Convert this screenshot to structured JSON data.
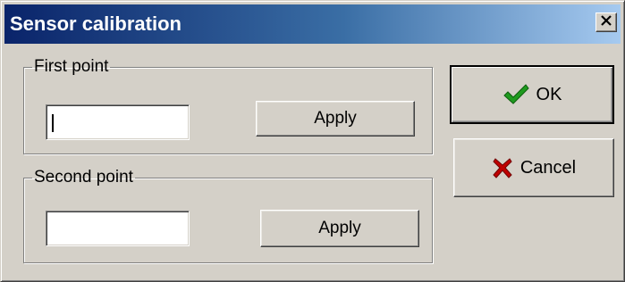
{
  "window": {
    "title": "Sensor calibration",
    "close_label": "X"
  },
  "groups": [
    {
      "legend": "First point",
      "input_value": "",
      "apply_label": "Apply"
    },
    {
      "legend": "Second point",
      "input_value": "",
      "apply_label": "Apply"
    }
  ],
  "actions": {
    "ok_label": "OK",
    "cancel_label": "Cancel",
    "ok_icon": "checkmark-icon",
    "cancel_icon": "red-x-icon"
  },
  "colors": {
    "title_gradient_start": "#0a246a",
    "title_gradient_end": "#a6caf0",
    "face": "#d4d0c8",
    "check_green": "#1f9a1f",
    "cancel_red": "#c00000"
  }
}
